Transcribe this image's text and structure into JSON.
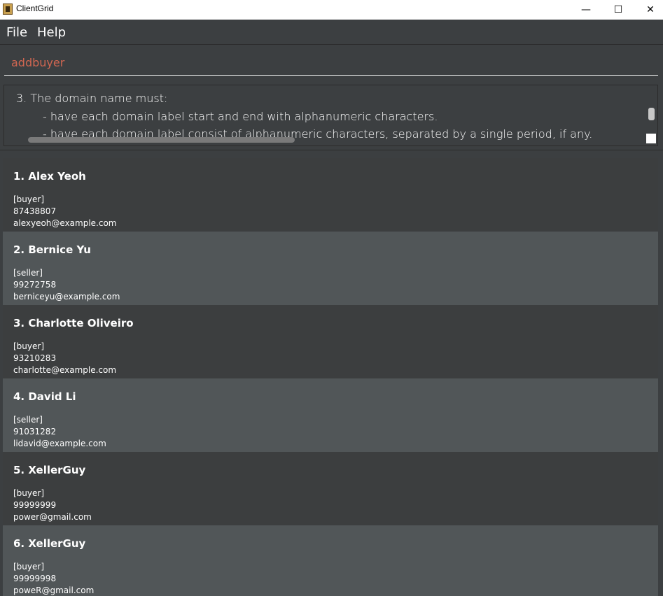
{
  "window": {
    "title": "ClientGrid",
    "controls": {
      "minimize": "—",
      "maximize": "☐",
      "close": "✕"
    }
  },
  "menu": {
    "file": "File",
    "help": "Help"
  },
  "command": {
    "value": "addbuyer"
  },
  "result": {
    "lines": [
      "3. The domain name must:",
      "- have each domain label start and end with alphanumeric characters.",
      "- have each domain label consist of alphanumeric characters, separated by a single period, if any."
    ]
  },
  "persons": [
    {
      "name": "1. Alex Yeoh",
      "role": "[buyer]",
      "phone": "87438807",
      "email": "alexyeoh@example.com"
    },
    {
      "name": "2. Bernice Yu",
      "role": "[seller]",
      "phone": "99272758",
      "email": "berniceyu@example.com"
    },
    {
      "name": "3. Charlotte Oliveiro",
      "role": "[buyer]",
      "phone": "93210283",
      "email": "charlotte@example.com"
    },
    {
      "name": "4. David Li",
      "role": "[seller]",
      "phone": "91031282",
      "email": "lidavid@example.com"
    },
    {
      "name": "5. XellerGuy",
      "role": "[buyer]",
      "phone": "99999999",
      "email": "power@gmail.com"
    },
    {
      "name": "6. XellerGuy",
      "role": "[buyer]",
      "phone": "99999998",
      "email": "poweR@gmail.com"
    }
  ],
  "colors": {
    "background": "#3c3f41",
    "card_dark": "#3c3e3f",
    "card_light": "#515658",
    "command_text": "#d06651",
    "text": "#ffffff"
  }
}
